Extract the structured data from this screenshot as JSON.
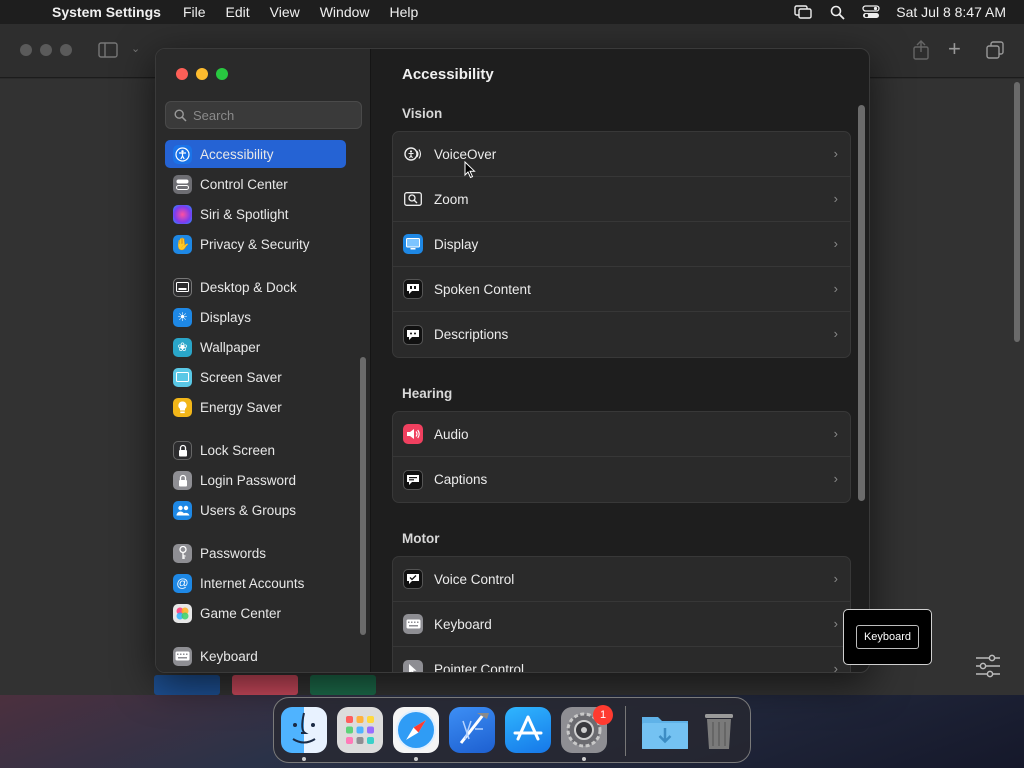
{
  "menubar": {
    "app_name": "System Settings",
    "menus": [
      "File",
      "Edit",
      "View",
      "Window",
      "Help"
    ],
    "clock": "Sat Jul 8  8:47 AM"
  },
  "sidebar": {
    "search_placeholder": "Search",
    "items": [
      {
        "label": "Accessibility",
        "icon": "accessibility-icon",
        "color": "#1a73e8"
      },
      {
        "label": "Control Center",
        "icon": "control-center-icon",
        "color": "#6e6e73"
      },
      {
        "label": "Siri & Spotlight",
        "icon": "siri-icon",
        "color": "#b04ad6"
      },
      {
        "label": "Privacy & Security",
        "icon": "hand-icon",
        "color": "#1e88e5"
      },
      {
        "label": "Desktop & Dock",
        "icon": "dock-icon",
        "color": "#2c2c2e"
      },
      {
        "label": "Displays",
        "icon": "sun-icon",
        "color": "#1e88e5"
      },
      {
        "label": "Wallpaper",
        "icon": "wallpaper-icon",
        "color": "#2aa6c9"
      },
      {
        "label": "Screen Saver",
        "icon": "screen-saver-icon",
        "color": "#5ac8e6"
      },
      {
        "label": "Energy Saver",
        "icon": "bulb-icon",
        "color": "#f2b619"
      },
      {
        "label": "Lock Screen",
        "icon": "lock-icon",
        "color": "#2c2c2e"
      },
      {
        "label": "Login Password",
        "icon": "login-password-icon",
        "color": "#8e8e93"
      },
      {
        "label": "Users & Groups",
        "icon": "users-icon",
        "color": "#1e88e5"
      },
      {
        "label": "Passwords",
        "icon": "key-icon",
        "color": "#8e8e93"
      },
      {
        "label": "Internet Accounts",
        "icon": "at-icon",
        "color": "#1e88e5"
      },
      {
        "label": "Game Center",
        "icon": "game-center-icon",
        "color": "#e0e0e0"
      },
      {
        "label": "Keyboard",
        "icon": "keyboard-icon",
        "color": "#8e8e93"
      }
    ]
  },
  "main": {
    "title": "Accessibility",
    "sections": [
      {
        "title": "Vision",
        "rows": [
          {
            "label": "VoiceOver",
            "icon": "voiceover-icon"
          },
          {
            "label": "Zoom",
            "icon": "zoom-icon"
          },
          {
            "label": "Display",
            "icon": "display-icon"
          },
          {
            "label": "Spoken Content",
            "icon": "spoken-content-icon"
          },
          {
            "label": "Descriptions",
            "icon": "descriptions-icon"
          }
        ]
      },
      {
        "title": "Hearing",
        "rows": [
          {
            "label": "Audio",
            "icon": "audio-icon"
          },
          {
            "label": "Captions",
            "icon": "captions-icon"
          }
        ]
      },
      {
        "title": "Motor",
        "rows": [
          {
            "label": "Voice Control",
            "icon": "voice-control-icon"
          },
          {
            "label": "Keyboard",
            "icon": "keyboard-icon"
          },
          {
            "label": "Pointer Control",
            "icon": "pointer-icon"
          }
        ]
      }
    ]
  },
  "tooltip": {
    "label": "Keyboard"
  },
  "dock": {
    "apps": [
      "Finder",
      "Launchpad",
      "Safari",
      "Xcode",
      "App Store",
      "System Settings",
      "Downloads",
      "Trash"
    ],
    "settings_badge": "1"
  },
  "colors": {
    "accent": "#2563d4",
    "badge": "#ff3b30"
  }
}
